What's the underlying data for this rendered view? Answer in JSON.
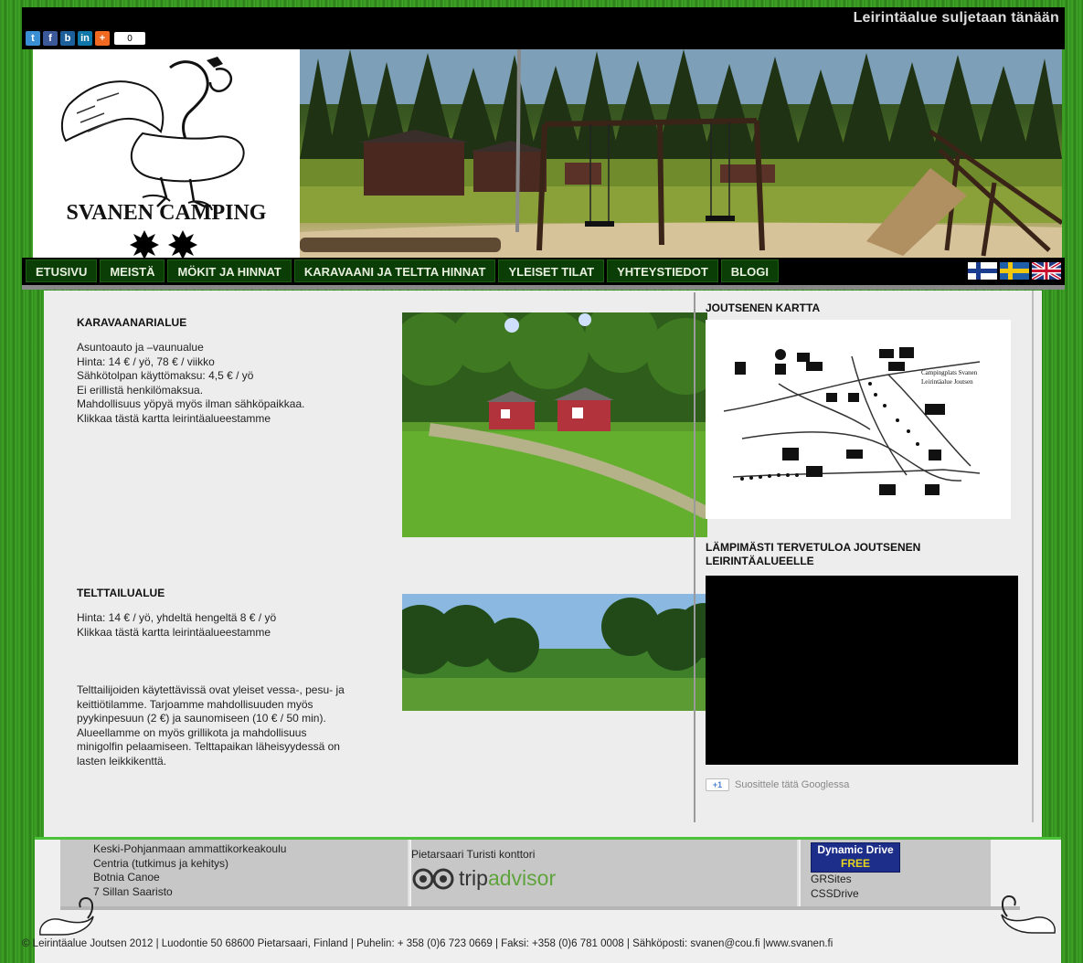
{
  "topbar": {
    "share_count": "0",
    "marquee_text": "Leirintäalue suljetaan tänään"
  },
  "header": {
    "logo_title": "SVANEN CAMPING"
  },
  "nav": {
    "items": [
      "ETUSIVU",
      "MEISTÄ",
      "MÖKIT JA HINNAT",
      "KARAVAANI JA TELTTA HINNAT",
      "YLEISET TILAT",
      "YHTEYSTIEDOT",
      "BLOGI"
    ],
    "flags": [
      "finnish-flag",
      "swedish-flag",
      "uk-flag"
    ]
  },
  "main": {
    "caravan": {
      "title": "KARAVAANARIALUE",
      "lines": [
        "Asuntoauto ja –vaunualue",
        "Hinta: 14 € / yö, 78 € / viikko",
        "Sähkötolpan käyttömaksu: 4,5 € / yö",
        "Ei erillistä henkilömaksua.",
        "Mahdollisuus yöpyä myös ilman sähköpaikkaa.",
        "Klikkaa tästä kartta leirintäalueestamme"
      ]
    },
    "tent": {
      "title": "TELTTAILUALUE",
      "lines": [
        "Hinta: 14 € / yö, yhdeltä hengeltä 8 € / yö",
        "Klikkaa tästä kartta leirintäalueestamme"
      ],
      "description": [
        "Telttailijoiden käytettävissä ovat yleiset vessa-, pesu- ja",
        "keittiötilamme. Tarjoamme mahdollisuuden myös",
        "pyykinpesuun (2 €) ja saunomiseen (10 € / 50 min).",
        "Alueellamme on myös grillikota ja mahdollisuus",
        "minigolfin pelaamiseen. Telttapaikan läheisyydessä on",
        "lasten leikkikenttä."
      ]
    }
  },
  "sidebar": {
    "map_title": "JOUTSENEN KARTTA",
    "map_caption": "Campingplats Svanen",
    "map_caption2": "Leirintäalue Joutsen",
    "welcome_line1": "LÄMPIMÄSTI TERVETULOA JOUTSENEN",
    "welcome_line2": "LEIRINTÄALUEELLE",
    "gplus_badge": "+1",
    "gplus_label": "Suosittele tätä Googlessa"
  },
  "footer": {
    "col1": [
      "Keski-Pohjanmaan ammattikorkeakoulu",
      "Centria (tutkimus ja kehitys)",
      "Botnia Canoe",
      "7 Sillan Saaristo"
    ],
    "col2_title": "Pietarsaari Turisti konttori",
    "trip": "trip",
    "advisor": "advisor",
    "dd_line1": "Dynamic Drive",
    "dd_line2": "FREE",
    "col3": [
      "GRSites",
      "CSSDrive"
    ],
    "copyright": "© Leirintäalue Joutsen 2012 | Luodontie 50 68600 Pietarsaari, Finland | Puhelin: + 358 (0)6 723 0669 | Faksi: +358 (0)6 781 0008 | Sähköposti: svanen@cou.fi |www.svanen.fi"
  }
}
